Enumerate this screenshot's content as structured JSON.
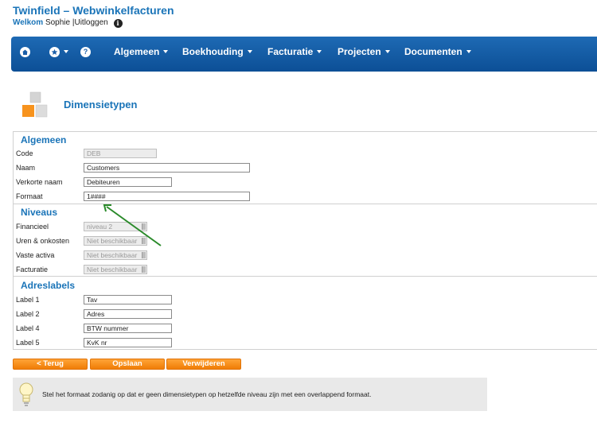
{
  "header": {
    "app_title": "Twinfield – Webwinkelfacturen",
    "welcome_label": "Welkom",
    "user_name": "Sophie",
    "separator": "|",
    "logout_label": "Uitloggen",
    "info_glyph": "i"
  },
  "navbar": {
    "home_icon": "home-icon",
    "favorites_icon": "star-icon",
    "help_icon": "help-icon",
    "help_glyph": "?",
    "menus": [
      {
        "label": "Algemeen"
      },
      {
        "label": "Boekhouding"
      },
      {
        "label": "Facturatie"
      },
      {
        "label": "Projecten"
      },
      {
        "label": "Documenten"
      }
    ]
  },
  "page": {
    "title": "Dimensietypen",
    "icon": "boxes-icon"
  },
  "form": {
    "algemeen": {
      "heading": "Algemeen",
      "rows": [
        {
          "label": "Code",
          "value": "DEB"
        },
        {
          "label": "Naam",
          "value": "Customers"
        },
        {
          "label": "Verkorte naam",
          "value": "Debiteuren"
        },
        {
          "label": "Formaat",
          "value": "1####"
        }
      ]
    },
    "niveaus": {
      "heading": "Niveaus",
      "rows": [
        {
          "label": "Financieel",
          "value": "niveau 2"
        },
        {
          "label": "Uren & onkosten",
          "value": "Niet beschikbaar"
        },
        {
          "label": "Vaste activa",
          "value": "Niet beschikbaar"
        },
        {
          "label": "Facturatie",
          "value": "Niet beschikbaar"
        }
      ]
    },
    "adreslabels": {
      "heading": "Adreslabels",
      "rows": [
        {
          "label": "Label 1",
          "value": "Tav"
        },
        {
          "label": "Label 2",
          "value": "Adres"
        },
        {
          "label": "Label 4",
          "value": "BTW nummer"
        },
        {
          "label": "Label 5",
          "value": "KvK nr"
        }
      ]
    }
  },
  "buttons": {
    "back": "< Terug",
    "save": "Opslaan",
    "delete": "Verwijderen"
  },
  "tip": {
    "icon": "lightbulb-icon",
    "text": "Stel het formaat zodanig op dat er geen dimensietypen op hetzelfde niveau zijn met een overlappend formaat."
  },
  "colors": {
    "accent": "#1a74b8",
    "navbar": "#0c4f96",
    "button": "#f7931e",
    "annotation_arrow": "#2a8a2a"
  }
}
